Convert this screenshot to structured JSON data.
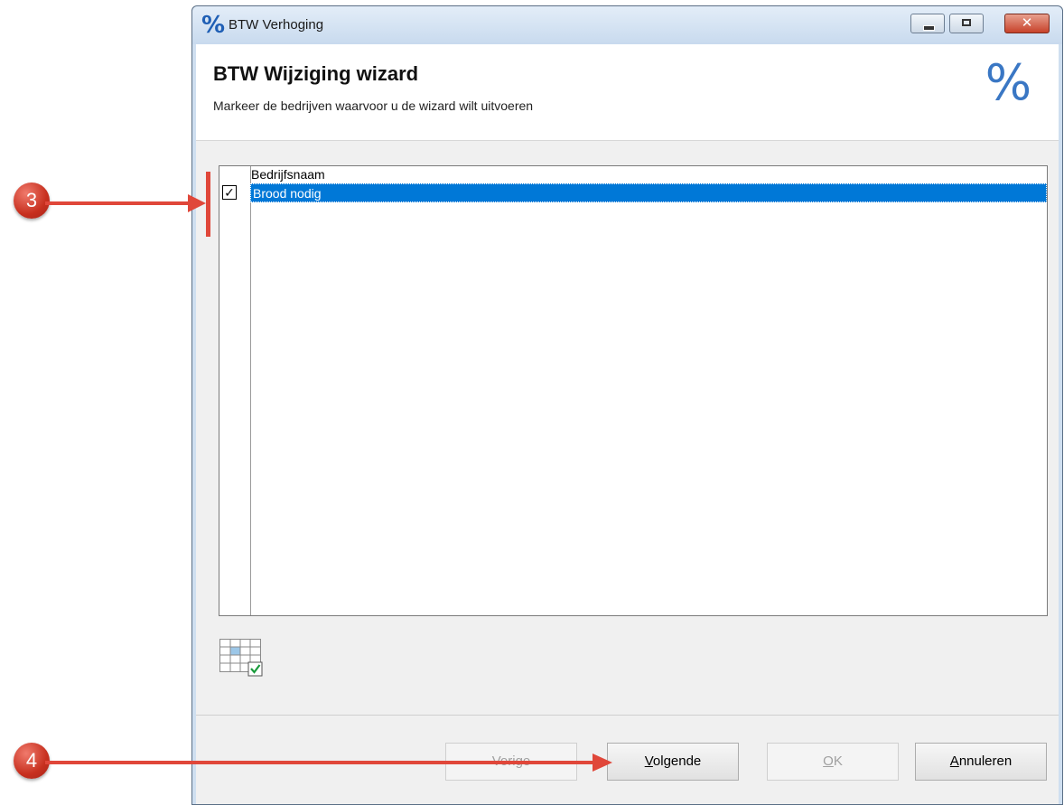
{
  "window": {
    "title": "BTW Verhoging",
    "title_icon": "%"
  },
  "header": {
    "title": "BTW Wijziging wizard",
    "subtitle": "Markeer de bedrijven waarvoor u de wizard wilt uitvoeren",
    "icon": "%"
  },
  "grid": {
    "column_header": "Bedrijfsnaam",
    "rows": [
      {
        "checked": true,
        "check_glyph": "☑",
        "name": "Brood nodig"
      }
    ]
  },
  "footer": {
    "prev_label": "Vorige",
    "next_label_u": "V",
    "next_label_rest": "olgende",
    "ok_label_u": "O",
    "ok_label_rest": "K",
    "cancel_label_u": "A",
    "cancel_label_rest": "nnuleren"
  },
  "annotations": [
    {
      "number": "3"
    },
    {
      "number": "4"
    }
  ],
  "colors": {
    "selection": "#0078d7",
    "annotation_red": "#e0473a",
    "accent_blue": "#3a77c4"
  }
}
